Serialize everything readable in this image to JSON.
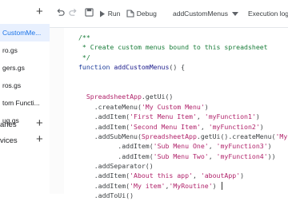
{
  "sidebar": {
    "files": [
      {
        "name": "CustomMe...",
        "active": true
      },
      {
        "name": "ro.gs",
        "active": false
      },
      {
        "name": "gers.gs",
        "active": false
      },
      {
        "name": "ros.gs",
        "active": false
      },
      {
        "name": "tom Functi...",
        "active": false
      },
      {
        "name": "ug.gs",
        "active": false
      }
    ],
    "libraries_label": "aries",
    "services_label": "vices"
  },
  "toolbar": {
    "run_label": "Run",
    "debug_label": "Debug",
    "function_select": "addCustomMenus",
    "execution_log_label": "Execution log"
  },
  "code": {
    "lines": [
      [
        {
          "t": "/**",
          "c": "cm"
        }
      ],
      [
        {
          "t": " * Create custom menus bound to this spreadsheet",
          "c": "cm"
        }
      ],
      [
        {
          "t": " */",
          "c": "cm"
        }
      ],
      [
        {
          "t": "function ",
          "c": "kw"
        },
        {
          "t": "addCustomMenus",
          "c": "fn"
        },
        {
          "t": "() {",
          "c": ""
        }
      ],
      [
        {
          "t": "",
          "c": ""
        }
      ],
      [
        {
          "t": "",
          "c": ""
        }
      ],
      [
        {
          "t": "  ",
          "c": ""
        },
        {
          "t": "SpreadsheetApp",
          "c": "ob"
        },
        {
          "t": ".getUi()",
          "c": ""
        }
      ],
      [
        {
          "t": "    .createMenu(",
          "c": ""
        },
        {
          "t": "'My Custom Menu'",
          "c": "str"
        },
        {
          "t": ")",
          "c": ""
        }
      ],
      [
        {
          "t": "    .addItem(",
          "c": ""
        },
        {
          "t": "'First Menu Item'",
          "c": "str"
        },
        {
          "t": ", ",
          "c": ""
        },
        {
          "t": "'myFunction1'",
          "c": "str"
        },
        {
          "t": ")",
          "c": ""
        }
      ],
      [
        {
          "t": "    .addItem(",
          "c": ""
        },
        {
          "t": "'Second Menu Item'",
          "c": "str"
        },
        {
          "t": ", ",
          "c": ""
        },
        {
          "t": "'myFunction2'",
          "c": "str"
        },
        {
          "t": ")",
          "c": ""
        }
      ],
      [
        {
          "t": "    .addSubMenu(",
          "c": ""
        },
        {
          "t": "SpreadsheetApp",
          "c": "ob"
        },
        {
          "t": ".getUi().createMenu(",
          "c": ""
        },
        {
          "t": "'My",
          "c": "str"
        }
      ],
      [
        {
          "t": "          .addItem(",
          "c": ""
        },
        {
          "t": "'Sub Menu One'",
          "c": "str"
        },
        {
          "t": ", ",
          "c": ""
        },
        {
          "t": "'myFunction3'",
          "c": "str"
        },
        {
          "t": ")",
          "c": ""
        }
      ],
      [
        {
          "t": "          .addItem(",
          "c": ""
        },
        {
          "t": "'Sub Menu Two'",
          "c": "str"
        },
        {
          "t": ", ",
          "c": ""
        },
        {
          "t": "'myFunction4'",
          "c": "str"
        },
        {
          "t": "))",
          "c": ""
        }
      ],
      [
        {
          "t": "    .addSeparator()",
          "c": ""
        }
      ],
      [
        {
          "t": "    .addItem(",
          "c": ""
        },
        {
          "t": "'About this app'",
          "c": "str"
        },
        {
          "t": ", ",
          "c": ""
        },
        {
          "t": "'aboutApp'",
          "c": "str"
        },
        {
          "t": ")",
          "c": ""
        }
      ],
      [
        {
          "t": "    .addItem(",
          "c": ""
        },
        {
          "t": "'My item'",
          "c": "str"
        },
        {
          "t": ",",
          "c": ""
        },
        {
          "t": "'MyRoutine'",
          "c": "str"
        },
        {
          "t": ")",
          "c": ""
        }
      ],
      [
        {
          "t": "    .addToUi()",
          "c": ""
        }
      ]
    ]
  }
}
